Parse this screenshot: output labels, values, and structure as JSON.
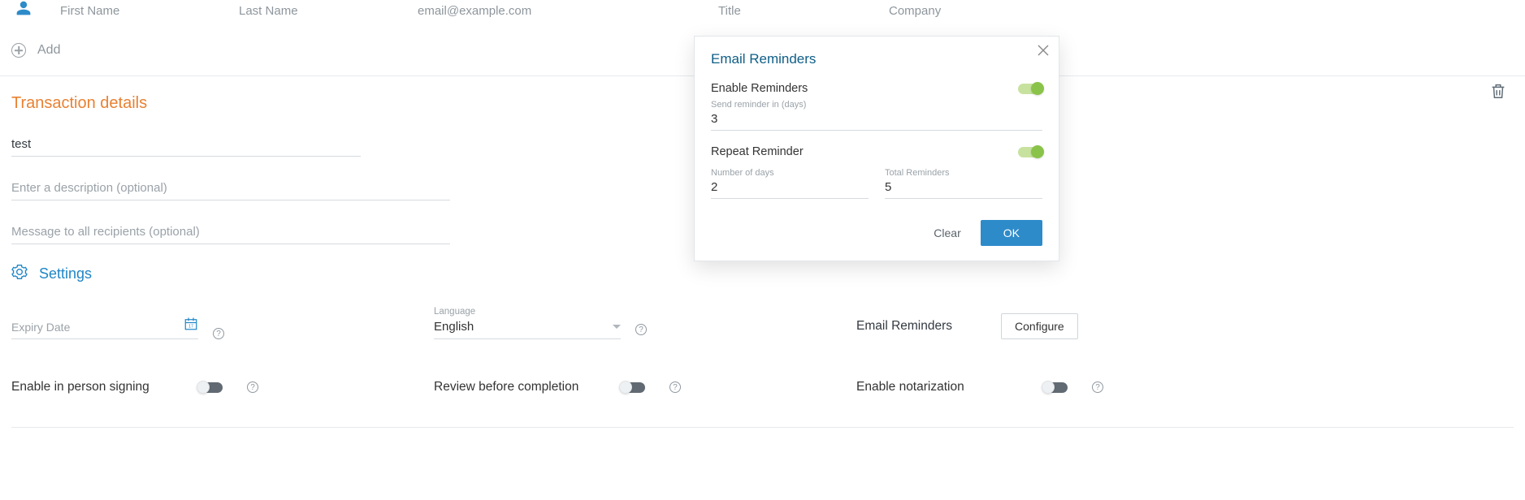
{
  "recipient": {
    "first_name_ph": "First Name",
    "last_name_ph": "Last Name",
    "email_ph": "email@example.com",
    "title_ph": "Title",
    "company_ph": "Company"
  },
  "add_label": "Add",
  "transaction": {
    "heading": "Transaction details",
    "name_value": "test",
    "description_ph": "Enter a description (optional)",
    "message_ph": "Message to all recipients (optional)"
  },
  "settings": {
    "heading": "Settings",
    "expiry_label": "Expiry Date",
    "language_label": "Language",
    "language_value": "English",
    "email_reminders_label": "Email Reminders",
    "configure_label": "Configure",
    "enable_in_person_label": "Enable in person signing",
    "review_before_label": "Review before completion",
    "enable_notarization_label": "Enable notarization"
  },
  "popover": {
    "title": "Email Reminders",
    "enable_label": "Enable Reminders",
    "send_in_label": "Send reminder in (days)",
    "send_in_value": "3",
    "repeat_label": "Repeat Reminder",
    "num_days_label": "Number of days",
    "num_days_value": "2",
    "total_label": "Total Reminders",
    "total_value": "5",
    "clear_label": "Clear",
    "ok_label": "OK"
  }
}
